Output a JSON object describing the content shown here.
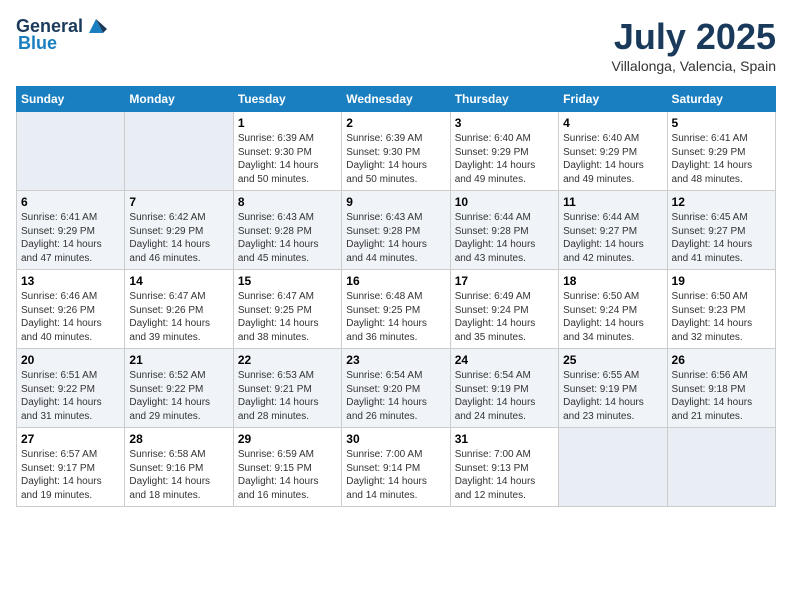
{
  "header": {
    "logo_general": "General",
    "logo_blue": "Blue",
    "month": "July 2025",
    "location": "Villalonga, Valencia, Spain"
  },
  "weekdays": [
    "Sunday",
    "Monday",
    "Tuesday",
    "Wednesday",
    "Thursday",
    "Friday",
    "Saturday"
  ],
  "weeks": [
    [
      {
        "day": "",
        "empty": true
      },
      {
        "day": "",
        "empty": true
      },
      {
        "day": "1",
        "sunrise": "6:39 AM",
        "sunset": "9:30 PM",
        "daylight": "14 hours and 50 minutes."
      },
      {
        "day": "2",
        "sunrise": "6:39 AM",
        "sunset": "9:30 PM",
        "daylight": "14 hours and 50 minutes."
      },
      {
        "day": "3",
        "sunrise": "6:40 AM",
        "sunset": "9:29 PM",
        "daylight": "14 hours and 49 minutes."
      },
      {
        "day": "4",
        "sunrise": "6:40 AM",
        "sunset": "9:29 PM",
        "daylight": "14 hours and 49 minutes."
      },
      {
        "day": "5",
        "sunrise": "6:41 AM",
        "sunset": "9:29 PM",
        "daylight": "14 hours and 48 minutes."
      }
    ],
    [
      {
        "day": "6",
        "sunrise": "6:41 AM",
        "sunset": "9:29 PM",
        "daylight": "14 hours and 47 minutes."
      },
      {
        "day": "7",
        "sunrise": "6:42 AM",
        "sunset": "9:29 PM",
        "daylight": "14 hours and 46 minutes."
      },
      {
        "day": "8",
        "sunrise": "6:43 AM",
        "sunset": "9:28 PM",
        "daylight": "14 hours and 45 minutes."
      },
      {
        "day": "9",
        "sunrise": "6:43 AM",
        "sunset": "9:28 PM",
        "daylight": "14 hours and 44 minutes."
      },
      {
        "day": "10",
        "sunrise": "6:44 AM",
        "sunset": "9:28 PM",
        "daylight": "14 hours and 43 minutes."
      },
      {
        "day": "11",
        "sunrise": "6:44 AM",
        "sunset": "9:27 PM",
        "daylight": "14 hours and 42 minutes."
      },
      {
        "day": "12",
        "sunrise": "6:45 AM",
        "sunset": "9:27 PM",
        "daylight": "14 hours and 41 minutes."
      }
    ],
    [
      {
        "day": "13",
        "sunrise": "6:46 AM",
        "sunset": "9:26 PM",
        "daylight": "14 hours and 40 minutes."
      },
      {
        "day": "14",
        "sunrise": "6:47 AM",
        "sunset": "9:26 PM",
        "daylight": "14 hours and 39 minutes."
      },
      {
        "day": "15",
        "sunrise": "6:47 AM",
        "sunset": "9:25 PM",
        "daylight": "14 hours and 38 minutes."
      },
      {
        "day": "16",
        "sunrise": "6:48 AM",
        "sunset": "9:25 PM",
        "daylight": "14 hours and 36 minutes."
      },
      {
        "day": "17",
        "sunrise": "6:49 AM",
        "sunset": "9:24 PM",
        "daylight": "14 hours and 35 minutes."
      },
      {
        "day": "18",
        "sunrise": "6:50 AM",
        "sunset": "9:24 PM",
        "daylight": "14 hours and 34 minutes."
      },
      {
        "day": "19",
        "sunrise": "6:50 AM",
        "sunset": "9:23 PM",
        "daylight": "14 hours and 32 minutes."
      }
    ],
    [
      {
        "day": "20",
        "sunrise": "6:51 AM",
        "sunset": "9:22 PM",
        "daylight": "14 hours and 31 minutes."
      },
      {
        "day": "21",
        "sunrise": "6:52 AM",
        "sunset": "9:22 PM",
        "daylight": "14 hours and 29 minutes."
      },
      {
        "day": "22",
        "sunrise": "6:53 AM",
        "sunset": "9:21 PM",
        "daylight": "14 hours and 28 minutes."
      },
      {
        "day": "23",
        "sunrise": "6:54 AM",
        "sunset": "9:20 PM",
        "daylight": "14 hours and 26 minutes."
      },
      {
        "day": "24",
        "sunrise": "6:54 AM",
        "sunset": "9:19 PM",
        "daylight": "14 hours and 24 minutes."
      },
      {
        "day": "25",
        "sunrise": "6:55 AM",
        "sunset": "9:19 PM",
        "daylight": "14 hours and 23 minutes."
      },
      {
        "day": "26",
        "sunrise": "6:56 AM",
        "sunset": "9:18 PM",
        "daylight": "14 hours and 21 minutes."
      }
    ],
    [
      {
        "day": "27",
        "sunrise": "6:57 AM",
        "sunset": "9:17 PM",
        "daylight": "14 hours and 19 minutes."
      },
      {
        "day": "28",
        "sunrise": "6:58 AM",
        "sunset": "9:16 PM",
        "daylight": "14 hours and 18 minutes."
      },
      {
        "day": "29",
        "sunrise": "6:59 AM",
        "sunset": "9:15 PM",
        "daylight": "14 hours and 16 minutes."
      },
      {
        "day": "30",
        "sunrise": "7:00 AM",
        "sunset": "9:14 PM",
        "daylight": "14 hours and 14 minutes."
      },
      {
        "day": "31",
        "sunrise": "7:00 AM",
        "sunset": "9:13 PM",
        "daylight": "14 hours and 12 minutes."
      },
      {
        "day": "",
        "empty": true
      },
      {
        "day": "",
        "empty": true
      }
    ]
  ]
}
